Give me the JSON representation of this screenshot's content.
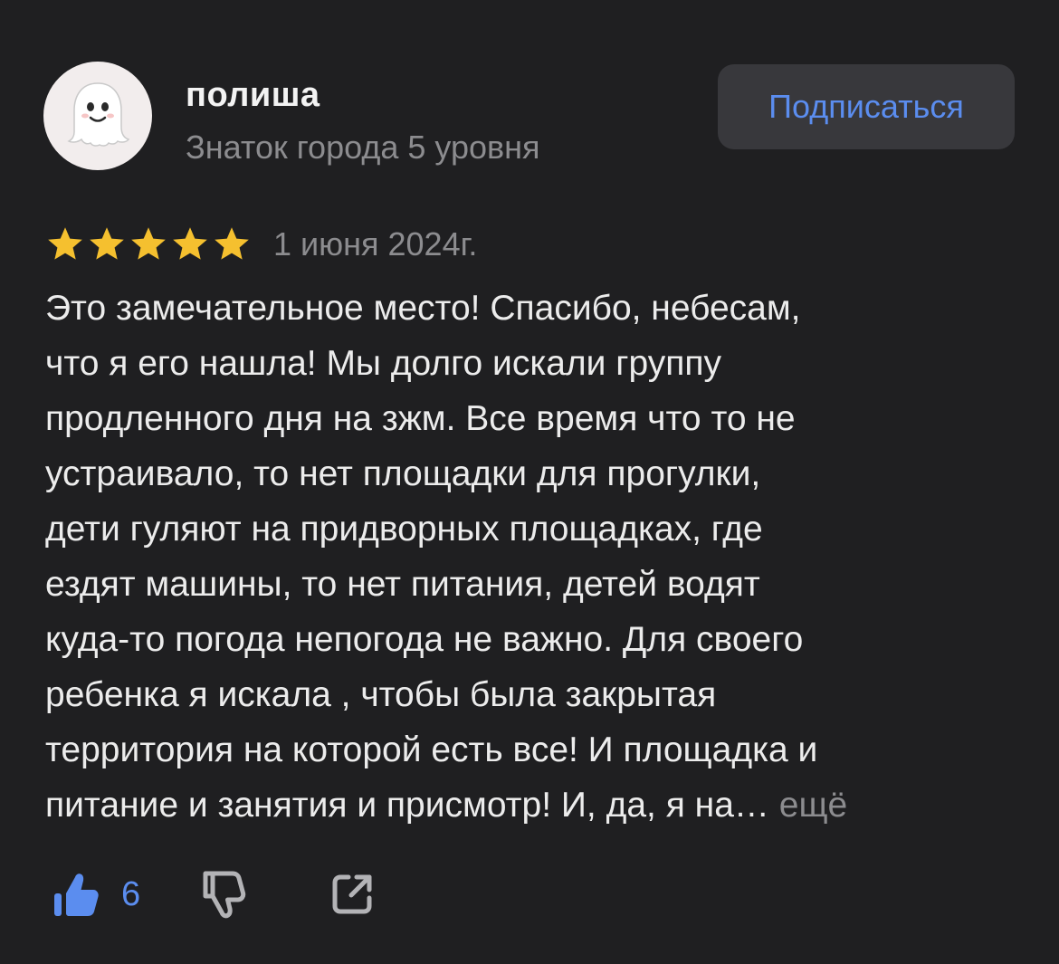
{
  "author": {
    "name": "полиша",
    "level": "Знаток города 5 уровня",
    "avatar_icon": "ghost-icon"
  },
  "subscribe_button": {
    "label": "Подписаться",
    "color": "#5b8def"
  },
  "review": {
    "rating": 5,
    "max_rating": 5,
    "star_color": "#f5c02f",
    "date": "1 июня 2024г.",
    "lines": [
      "Это замечательное место! Спасибо, небесам,",
      "что я его нашла! Мы долго искали группу",
      "продленного дня на зжм. Все время что то не",
      "устраивало, то нет площадки для прогулки,",
      "дети гуляют на придворных площадках, где",
      "ездят машины, то нет питания, детей водят",
      "куда-то погода непогода не важно. Для своего",
      "ребенка я искала , чтобы была закрытая",
      "территория на которой есть все! И площадка и",
      "питание и занятия и присмотр! И, да, я на…"
    ],
    "more_label": "ещё"
  },
  "actions": {
    "like_count": "6",
    "like_icon": "thumbs-up-icon",
    "dislike_icon": "thumbs-down-icon",
    "share_icon": "share-icon",
    "accent_color": "#5b8def"
  },
  "colors": {
    "background": "#1f1f21",
    "text": "#ececec",
    "muted": "#8c8c8f",
    "button_bg": "#38383c"
  }
}
